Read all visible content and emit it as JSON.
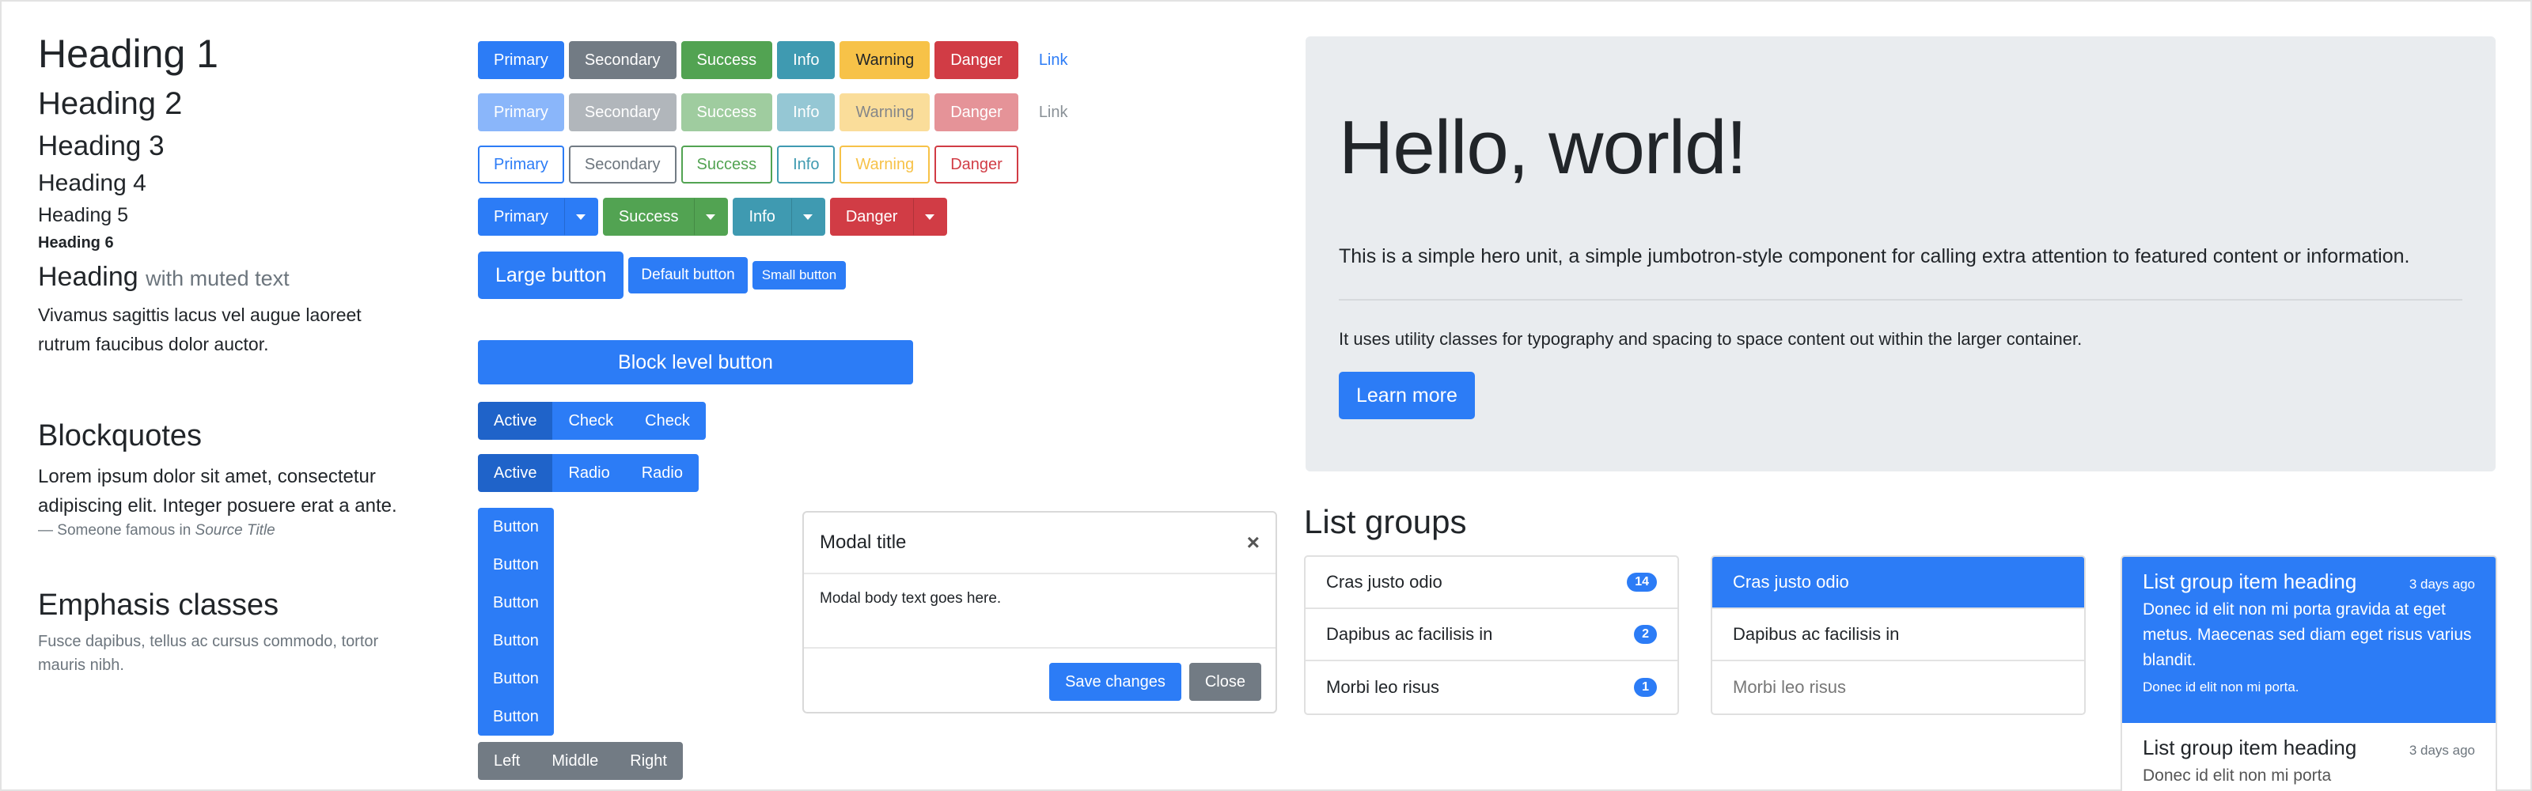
{
  "typography": {
    "h1": "Heading 1",
    "h2": "Heading 2",
    "h3": "Heading 3",
    "h4": "Heading 4",
    "h5": "Heading 5",
    "h6": "Heading 6",
    "heading_muted_main": "Heading",
    "heading_muted_small": "with muted text",
    "lead_paragraph": "Vivamus sagittis lacus vel augue laoreet rutrum faucibus dolor auctor."
  },
  "blockquotes": {
    "title": "Blockquotes",
    "text": "Lorem ipsum dolor sit amet, consectetur adipiscing elit. Integer posuere erat a ante.",
    "footer_prefix": "— Someone famous in ",
    "footer_source": "Source Title"
  },
  "emphasis": {
    "title": "Emphasis classes",
    "text": "Fusce dapibus, tellus ac cursus commodo, tortor mauris nibh."
  },
  "buttons": {
    "solid": [
      "Primary",
      "Secondary",
      "Success",
      "Info",
      "Warning",
      "Danger",
      "Link"
    ],
    "disabled": [
      "Primary",
      "Secondary",
      "Success",
      "Info",
      "Warning",
      "Danger",
      "Link"
    ],
    "outline": [
      "Primary",
      "Secondary",
      "Success",
      "Info",
      "Warning",
      "Danger"
    ],
    "split": [
      "Primary",
      "Success",
      "Info",
      "Danger"
    ],
    "large": "Large button",
    "default": "Default button",
    "small": "Small button",
    "block": "Block level button",
    "checkbox_group": [
      "Active",
      "Check",
      "Check"
    ],
    "radio_group": [
      "Active",
      "Radio",
      "Radio"
    ],
    "vertical_group": [
      "Button",
      "Button",
      "Button",
      "Button",
      "Button",
      "Button"
    ],
    "horizontal_group": [
      "Left",
      "Middle",
      "Right"
    ]
  },
  "modal": {
    "title": "Modal title",
    "close_glyph": "×",
    "body": "Modal body text goes here.",
    "save": "Save changes",
    "close": "Close"
  },
  "jumbotron": {
    "title": "Hello, world!",
    "lead": "This is a simple hero unit, a simple jumbotron-style component for calling extra attention to featured content or information.",
    "text": "It uses utility classes for typography and spacing to space content out within the larger container.",
    "button": "Learn more"
  },
  "list_groups": {
    "title": "List groups",
    "badged": [
      {
        "label": "Cras justo odio",
        "badge": "14"
      },
      {
        "label": "Dapibus ac facilisis in",
        "badge": "2"
      },
      {
        "label": "Morbi leo risus",
        "badge": "1"
      }
    ],
    "states": [
      "Cras justo odio",
      "Dapibus ac facilisis in",
      "Morbi leo risus"
    ],
    "custom": [
      {
        "heading": "List group item heading",
        "time": "3 days ago",
        "text": "Donec id elit non mi porta gravida at eget metus. Maecenas sed diam eget risus varius blandit.",
        "small": "Donec id elit non mi porta."
      },
      {
        "heading": "List group item heading",
        "time": "3 days ago",
        "text": "Donec id elit non mi porta"
      }
    ]
  },
  "colors": {
    "primary": "#2c7cf6",
    "secondary": "#727b84",
    "success": "#52a352",
    "info": "#3f9ab1",
    "warning": "#f7c248",
    "danger": "#d13c45",
    "jumbotron_bg": "#e9ecef"
  }
}
